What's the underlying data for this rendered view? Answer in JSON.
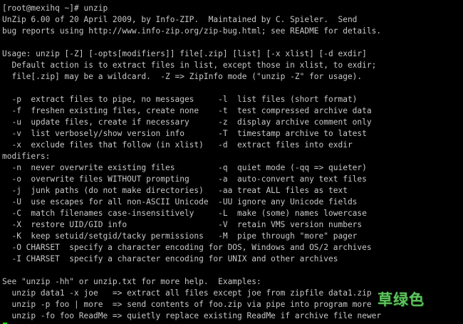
{
  "terminal": {
    "prompt": "[root@mexihq ~]# unzip",
    "lines": [
      "UnZip 6.00 of 20 April 2009, by Info-ZIP.  Maintained by C. Spieler.  Send",
      "bug reports using http://www.info-zip.org/zip-bug.html; see README for details.",
      "",
      "Usage: unzip [-Z] [-opts[modifiers]] file[.zip] [list] [-x xlist] [-d exdir]",
      "  Default action is to extract files in list, except those in xlist, to exdir;",
      "  file[.zip] may be a wildcard.  -Z => ZipInfo mode (\"unzip -Z\" for usage).",
      "",
      "  -p  extract files to pipe, no messages     -l  list files (short format)",
      "  -f  freshen existing files, create none    -t  test compressed archive data",
      "  -u  update files, create if necessary      -z  display archive comment only",
      "  -v  list verbosely/show version info       -T  timestamp archive to latest",
      "  -x  exclude files that follow (in xlist)   -d  extract files into exdir",
      "modifiers:",
      "  -n  never overwrite existing files         -q  quiet mode (-qq => quieter)",
      "  -o  overwrite files WITHOUT prompting      -a  auto-convert any text files",
      "  -j  junk paths (do not make directories)   -aa treat ALL files as text",
      "  -U  use escapes for all non-ASCII Unicode  -UU ignore any Unicode fields",
      "  -C  match filenames case-insensitively     -L  make (some) names lowercase",
      "  -X  restore UID/GID info                   -V  retain VMS version numbers",
      "  -K  keep setuid/setgid/tacky permissions   -M  pipe through \"more\" pager",
      "  -O CHARSET  specify a character encoding for DOS, Windows and OS/2 archives",
      "  -I CHARSET  specify a character encoding for UNIX and other archives",
      "",
      "See \"unzip -hh\" or unzip.txt for more help.  Examples:",
      "  unzip data1 -x joe   => extract all files except joe from zipfile data1.zip",
      "  unzip -p foo | more  => send contents of foo.zip via pipe into program more",
      "  unzip -fo foo ReadMe => quietly replace existing ReadMe if archive file newer"
    ],
    "cursor_color": "#19e119"
  },
  "watermark": {
    "text": "草绿色"
  }
}
